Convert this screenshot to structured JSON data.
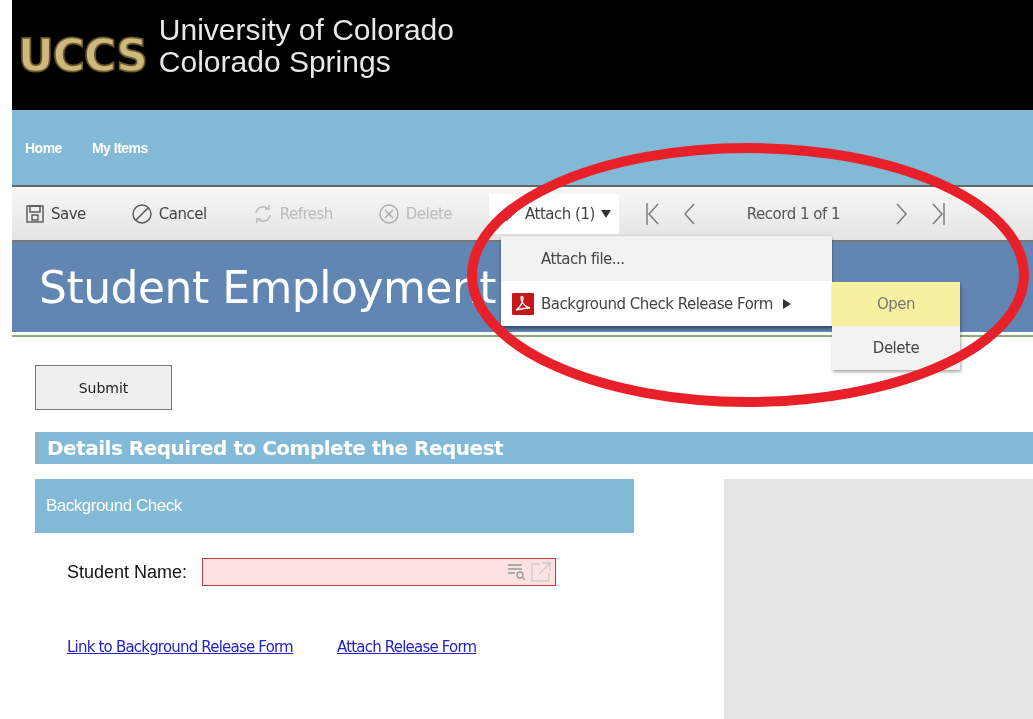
{
  "header": {
    "logo": "UCCS",
    "title_line_1": "University of Colorado",
    "title_line_2": "Colorado Springs"
  },
  "nav": [
    {
      "label": "Home"
    },
    {
      "label": "My Items"
    }
  ],
  "toolbar": {
    "buttons": [
      {
        "label": "Save",
        "kind": "save",
        "disabled": false
      },
      {
        "label": "Cancel",
        "kind": "cancel",
        "disabled": false
      },
      {
        "label": "Refresh",
        "kind": "refresh",
        "disabled": true
      },
      {
        "label": "Delete",
        "kind": "delete",
        "disabled": true
      }
    ],
    "attach": {
      "label": "Attach (1)",
      "expanded": true
    },
    "record": "Record 1 of 1"
  },
  "attach_menu": {
    "items": [
      {
        "label": "Attach file...",
        "kind": "action"
      },
      {
        "label": "Background Check Release Form",
        "kind": "file",
        "submenu": [
          {
            "label": "Open",
            "selected": true
          },
          {
            "label": "Delete",
            "selected": false
          }
        ]
      }
    ]
  },
  "page_title": "Student Employment",
  "submit": "Submit",
  "section": "Details Required to Complete the Request",
  "group": "Background Check",
  "field": {
    "label": "Student Name:",
    "invalid": true
  },
  "links": [
    {
      "label": "Link to Background Release Form"
    },
    {
      "label": "Attach Release Form"
    }
  ],
  "annotation": {
    "kind": "ellipse"
  }
}
